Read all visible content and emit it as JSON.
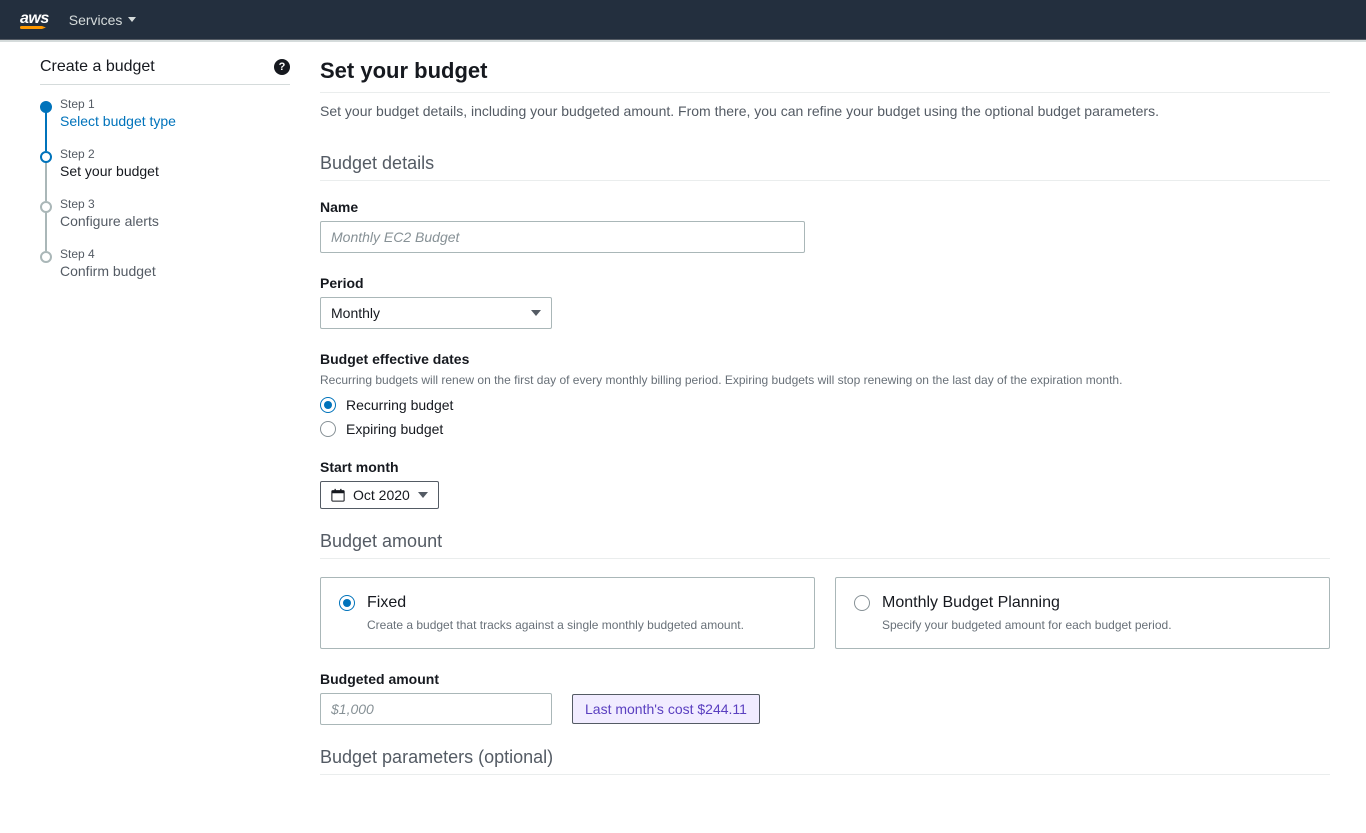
{
  "nav": {
    "logo": "aws",
    "services": "Services"
  },
  "sidebar": {
    "title": "Create a budget",
    "steps": [
      {
        "num": "Step 1",
        "label": "Select budget type"
      },
      {
        "num": "Step 2",
        "label": "Set your budget"
      },
      {
        "num": "Step 3",
        "label": "Configure alerts"
      },
      {
        "num": "Step 4",
        "label": "Confirm budget"
      }
    ]
  },
  "page": {
    "title": "Set your budget",
    "description": "Set your budget details, including your budgeted amount. From there, you can refine your budget using the optional budget parameters."
  },
  "details": {
    "section_title": "Budget details",
    "name_label": "Name",
    "name_placeholder": "Monthly EC2 Budget",
    "period_label": "Period",
    "period_value": "Monthly",
    "effective_dates_label": "Budget effective dates",
    "effective_dates_hint": "Recurring budgets will renew on the first day of every monthly billing period. Expiring budgets will stop renewing on the last day of the expiration month.",
    "recurring_label": "Recurring budget",
    "expiring_label": "Expiring budget",
    "start_month_label": "Start month",
    "start_month_value": "Oct 2020"
  },
  "amount": {
    "section_title": "Budget amount",
    "fixed_title": "Fixed",
    "fixed_desc": "Create a budget that tracks against a single monthly budgeted amount.",
    "planning_title": "Monthly Budget Planning",
    "planning_desc": "Specify your budgeted amount for each budget period.",
    "budgeted_label": "Budgeted amount",
    "budgeted_placeholder": "$1,000",
    "last_month_label": "Last month's cost $244.11"
  },
  "params": {
    "section_title": "Budget parameters (optional)"
  }
}
